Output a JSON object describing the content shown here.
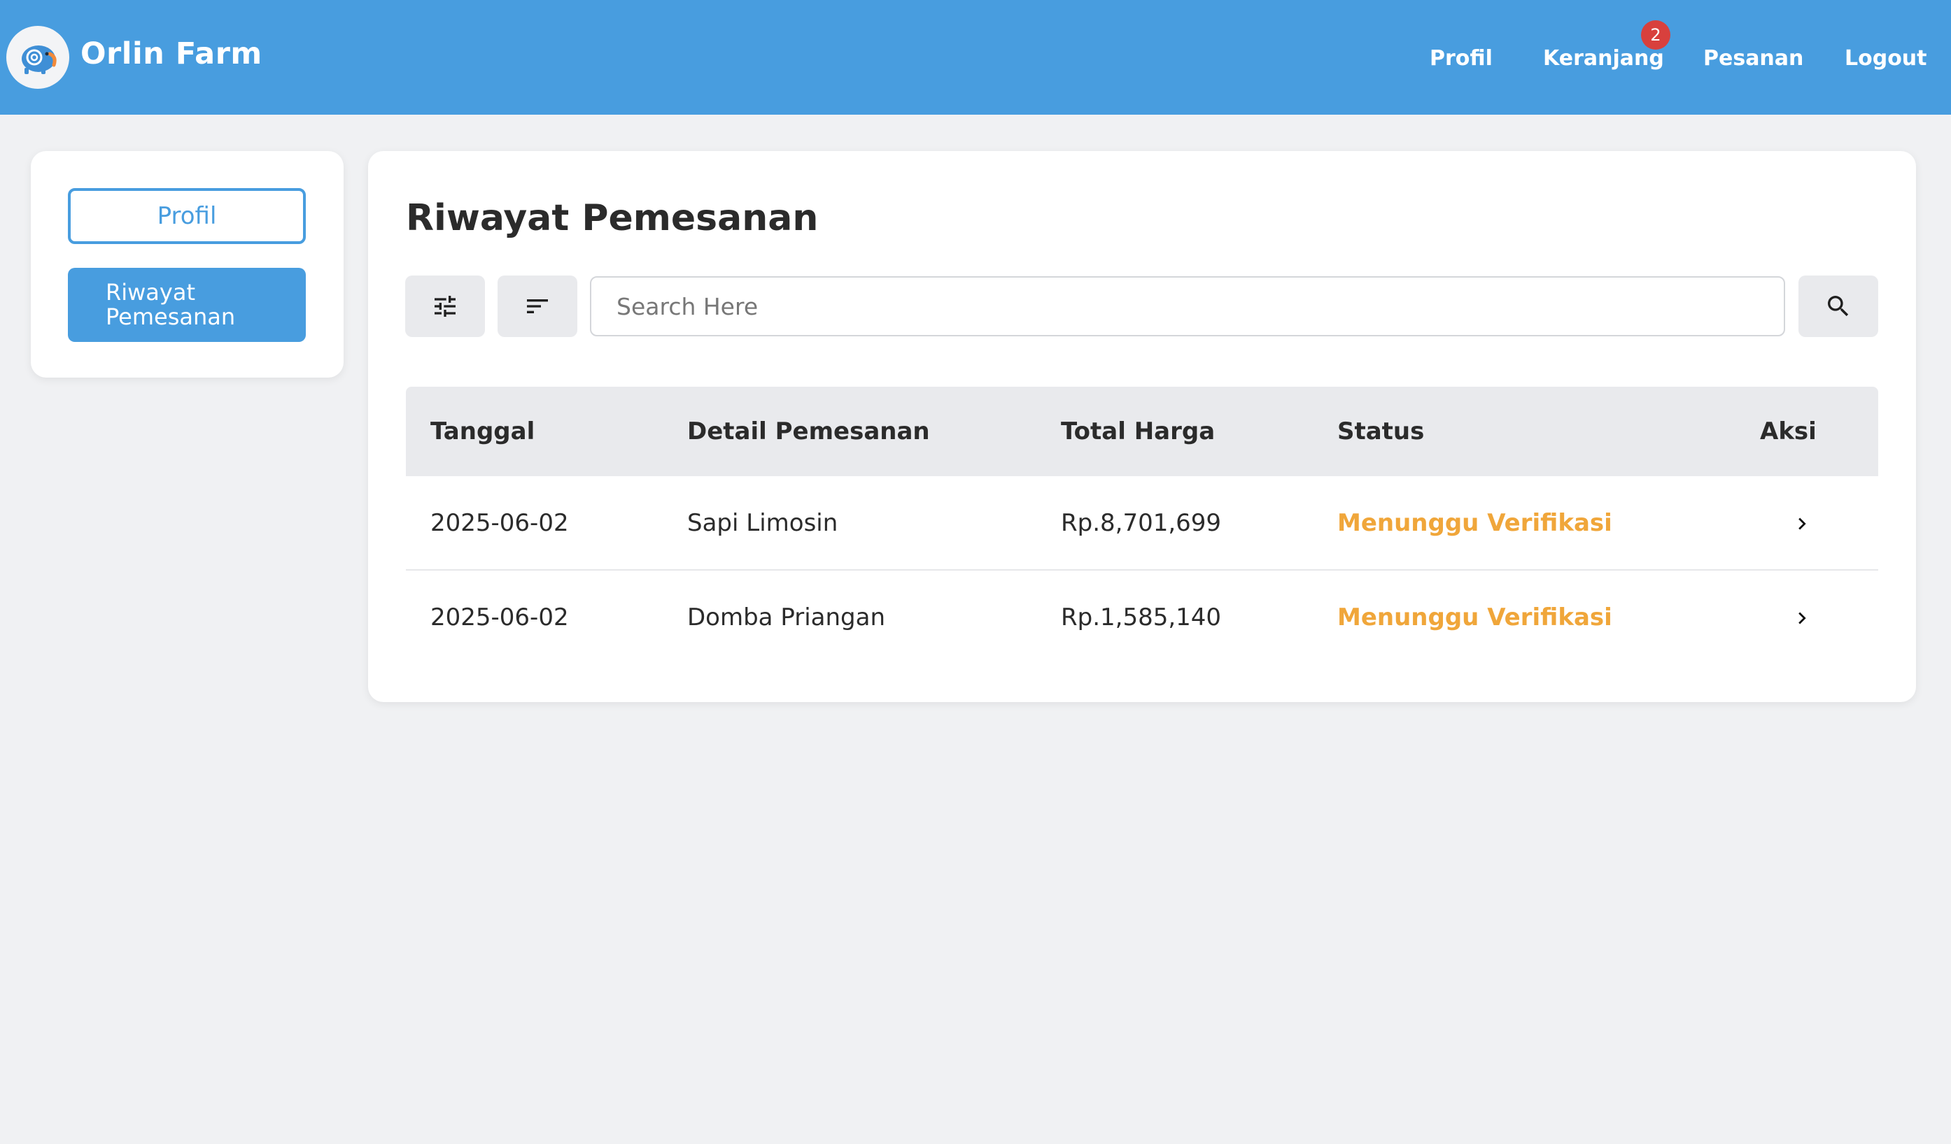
{
  "header": {
    "brand": "Orlin Farm",
    "nav": [
      {
        "label": "Profil"
      },
      {
        "label": "Keranjang",
        "badge": "2"
      },
      {
        "label": "Pesanan"
      },
      {
        "label": "Logout"
      }
    ]
  },
  "sidebar": {
    "items": [
      {
        "label": "Profil"
      },
      {
        "label": "Riwayat Pemesanan"
      }
    ]
  },
  "main": {
    "title": "Riwayat Pemesanan",
    "toolbar": {
      "filter_icon": "tune-icon",
      "sort_icon": "sort-icon",
      "search_placeholder": "Search Here",
      "search_icon": "search-icon"
    },
    "table": {
      "columns": [
        "Tanggal",
        "Detail Pemesanan",
        "Total Harga",
        "Status",
        "Aksi"
      ],
      "rows": [
        {
          "tanggal": "2025-06-02",
          "detail": "Sapi Limosin",
          "total": "Rp.8,701,699",
          "status": "Menunggu Verifikasi"
        },
        {
          "tanggal": "2025-06-02",
          "detail": "Domba Priangan",
          "total": "Rp.1,585,140",
          "status": "Menunggu Verifikasi"
        }
      ]
    }
  },
  "colors": {
    "primary": "#489ddf",
    "status_pending": "#f0a63a",
    "badge": "#d8403d",
    "background": "#f0f1f3"
  }
}
